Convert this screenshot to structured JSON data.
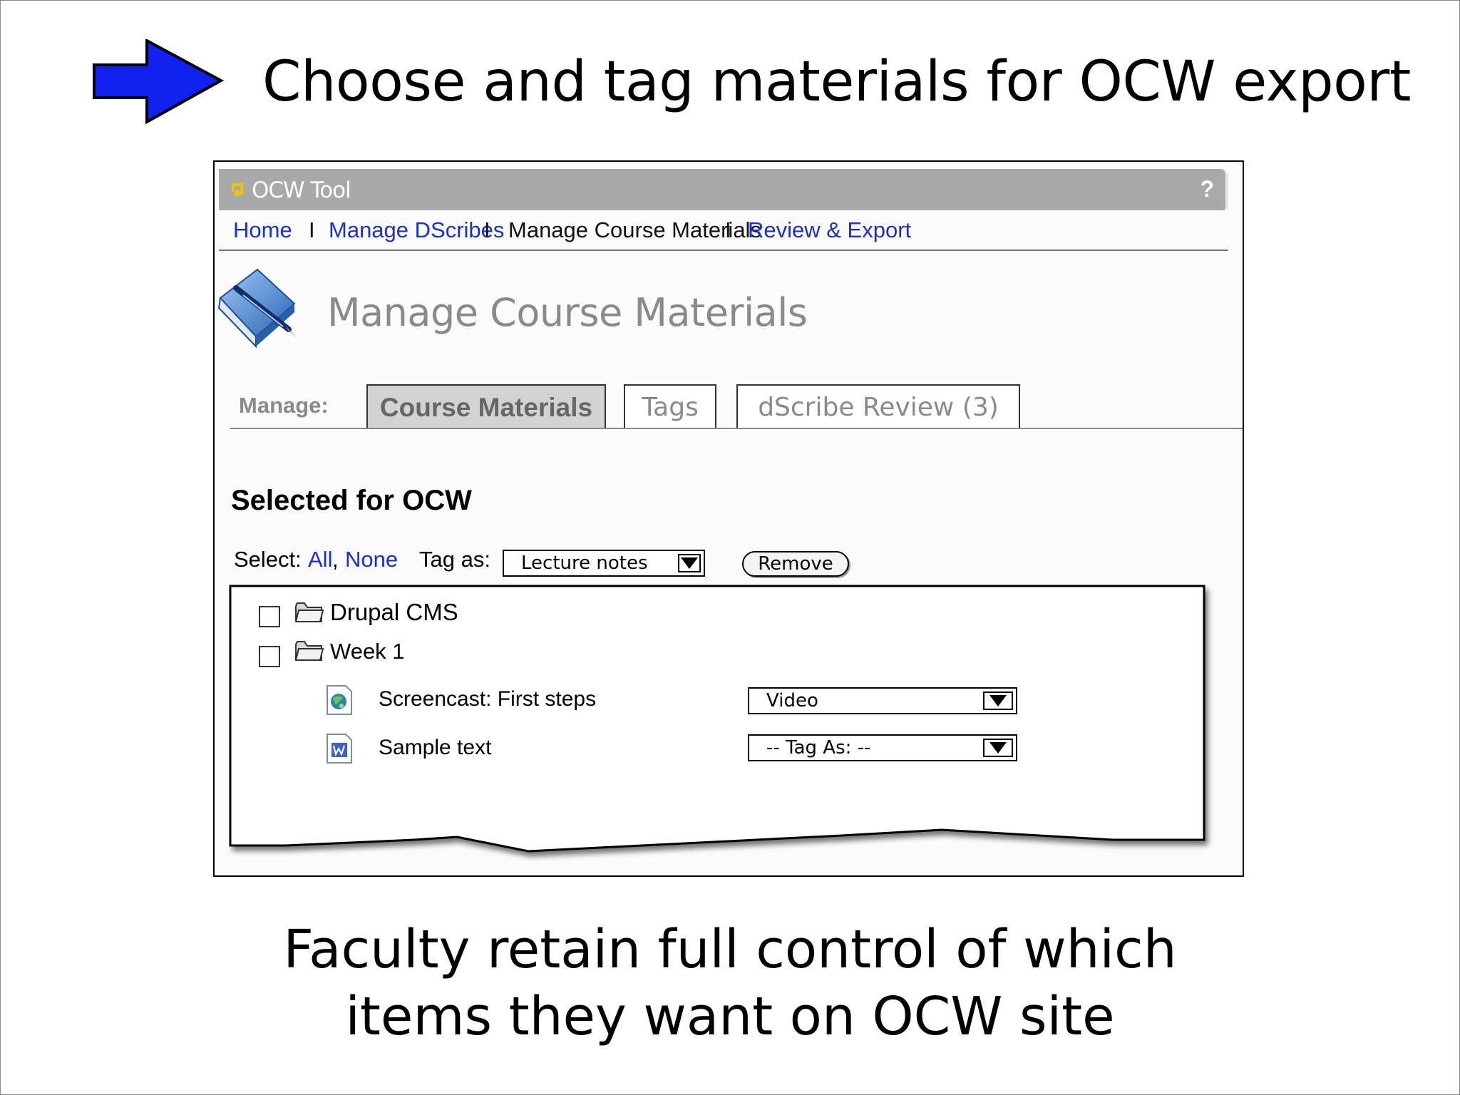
{
  "slide": {
    "title": "Choose and tag materials for OCW export",
    "caption_line1": "Faculty retain full control of which",
    "caption_line2": "items they want on OCW site"
  },
  "app": {
    "title": "OCW Tool",
    "help": "?"
  },
  "nav": {
    "items": [
      "Home",
      "Manage DScribes",
      "Manage Course Materials",
      "Review & Export"
    ],
    "separator": "I",
    "current": "Manage Course Materials"
  },
  "page": {
    "heading": "Manage Course Materials"
  },
  "tabs": {
    "label": "Manage:",
    "items": [
      "Course Materials",
      "Tags",
      "dScribe Review (3)"
    ],
    "active": "Course Materials"
  },
  "section": {
    "title": "Selected for OCW",
    "select_label": "Select:",
    "select_all": "All",
    "comma": ",",
    "select_none": "None",
    "tag_as_label": "Tag as:",
    "tag_as_value": "Lecture notes",
    "remove_label": "Remove"
  },
  "items": [
    {
      "name": "Drupal CMS",
      "type": "folder",
      "checked": false
    },
    {
      "name": "Week 1",
      "type": "folder",
      "checked": false
    },
    {
      "name": "Screencast: First steps",
      "type": "video-file",
      "tag": "Video"
    },
    {
      "name": "Sample text",
      "type": "word-document",
      "tag": "-- Tag As: --"
    }
  ],
  "colors": {
    "arrow": "#1122ee",
    "link": "#1a2fd0",
    "titlebar": "#a9a9aa",
    "app_icon": "#f2c200"
  }
}
